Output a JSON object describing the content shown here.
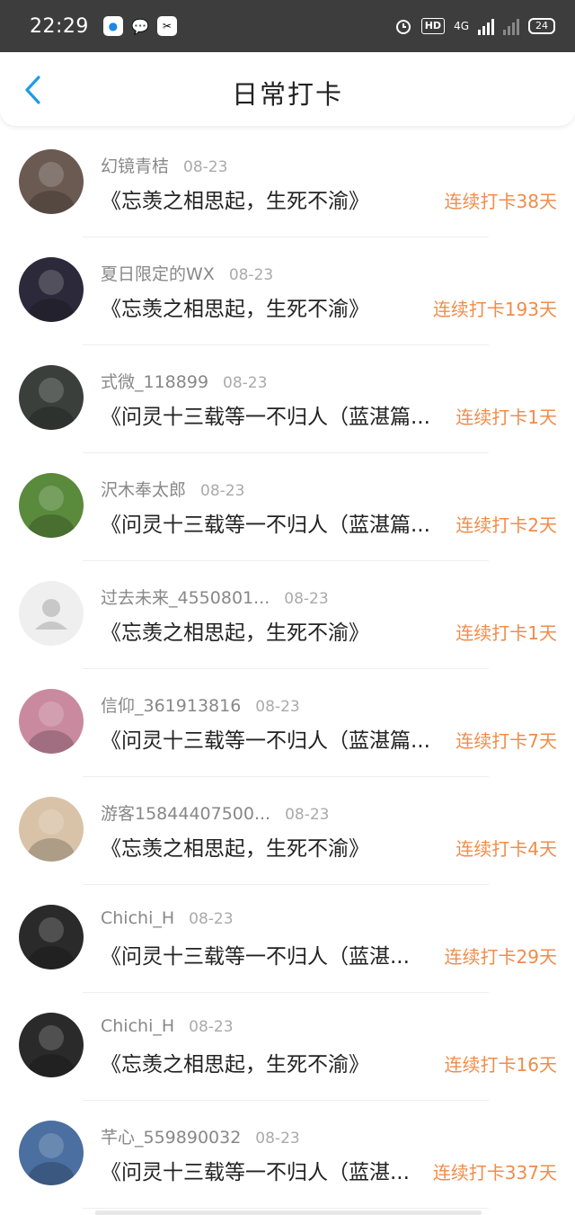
{
  "status_bar": {
    "time": "22:29",
    "network": "4G",
    "battery": "24",
    "hd_badge": "HD"
  },
  "nav": {
    "title": "日常打卡"
  },
  "entries": [
    {
      "name": "幻镜青桔",
      "date": "08-23",
      "book": "《忘羡之相思起，生死不渝》",
      "streak": "连续打卡38天",
      "avatar_color": "#6b5a52"
    },
    {
      "name": "夏日限定的WX",
      "date": "08-23",
      "book": "《忘羡之相思起，生死不渝》",
      "streak": "连续打卡193天",
      "avatar_color": "#2c2a3a"
    },
    {
      "name": "式微_118899",
      "date": "08-23",
      "book": "《问灵十三载等一不归人（蓝湛篇...",
      "streak": "连续打卡1天",
      "avatar_color": "#3a3f3b"
    },
    {
      "name": "沢木奉太郎",
      "date": "08-23",
      "book": "《问灵十三载等一不归人（蓝湛篇...",
      "streak": "连续打卡2天",
      "avatar_color": "#5a8a3c"
    },
    {
      "name": "过去未来_4550801...",
      "date": "08-23",
      "book": "《忘羡之相思起，生死不渝》",
      "streak": "连续打卡1天",
      "avatar_color": "#efefef"
    },
    {
      "name": "信仰_361913816",
      "date": "08-23",
      "book": "《问灵十三载等一不归人（蓝湛篇...",
      "streak": "连续打卡7天",
      "avatar_color": "#c98aa0"
    },
    {
      "name": "游客15844407500...",
      "date": "08-23",
      "book": "《忘羡之相思起，生死不渝》",
      "streak": "连续打卡4天",
      "avatar_color": "#d9c3a8"
    },
    {
      "name": "Chichi_H",
      "date": "08-23",
      "book": "《问灵十三载等一不归人（蓝湛...",
      "streak": "连续打卡29天",
      "avatar_color": "#2a2a2a"
    },
    {
      "name": "Chichi_H",
      "date": "08-23",
      "book": "《忘羡之相思起，生死不渝》",
      "streak": "连续打卡16天",
      "avatar_color": "#2a2a2a"
    },
    {
      "name": "芊心_559890032",
      "date": "08-23",
      "book": "《问灵十三载等一不归人（蓝湛...",
      "streak": "连续打卡337天",
      "avatar_color": "#4a6fa0"
    }
  ],
  "colors": {
    "accent_blue": "#1e9be9",
    "streak_orange": "#f08c4a"
  }
}
